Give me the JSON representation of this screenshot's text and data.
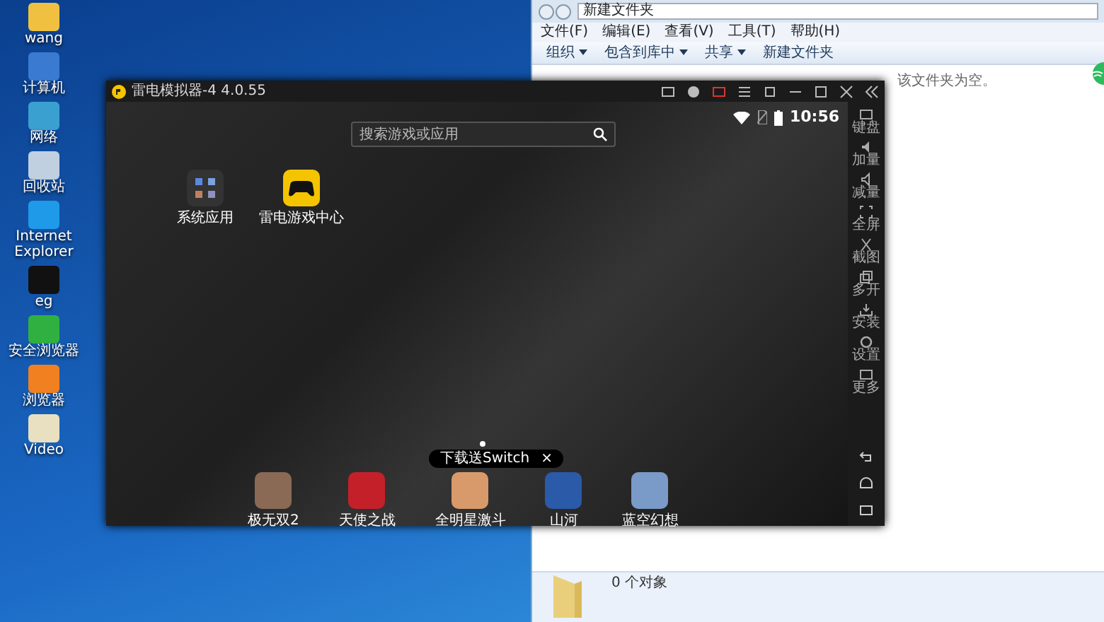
{
  "desktop_icons": [
    {
      "label": "wang"
    },
    {
      "label": "计算机"
    },
    {
      "label": "网络"
    },
    {
      "label": "回收站"
    },
    {
      "label": "Internet Explorer"
    },
    {
      "label": "eg"
    },
    {
      "label": "安全浏览器"
    },
    {
      "label": "浏览器"
    },
    {
      "label": "Video"
    }
  ],
  "explorer": {
    "address": "新建文件夹",
    "menu": [
      "文件(F)",
      "编辑(E)",
      "查看(V)",
      "工具(T)",
      "帮助(H)"
    ],
    "toolbar": [
      {
        "label": "组织",
        "dropdown": true
      },
      {
        "label": "包含到库中",
        "dropdown": true
      },
      {
        "label": "共享",
        "dropdown": true
      },
      {
        "label": "新建文件夹",
        "dropdown": false
      }
    ],
    "empty_message": "该文件夹为空。",
    "status": "0 个对象"
  },
  "emulator": {
    "title": "雷电模拟器-4 4.0.55",
    "time": "10:56",
    "search": {
      "placeholder": "搜索游戏或应用"
    },
    "home_apps": [
      {
        "label": "系统应用",
        "kind": "folder"
      },
      {
        "label": "雷电游戏中心",
        "kind": "gamepad"
      }
    ],
    "banner": {
      "text": "下载送Switch",
      "close": "×"
    },
    "dock_apps": [
      {
        "label": "极无双2",
        "color": "#8a6a55"
      },
      {
        "label": "天使之战",
        "color": "#c4202a"
      },
      {
        "label": "全明星激斗",
        "color": "#d89a6a"
      },
      {
        "label": "山河",
        "color": "#2a5aa8"
      },
      {
        "label": "蓝空幻想",
        "color": "#7a9ac8"
      }
    ],
    "sidebar": [
      {
        "label": "键盘"
      },
      {
        "label": "加量"
      },
      {
        "label": "减量"
      },
      {
        "label": "全屏"
      },
      {
        "label": "截图"
      },
      {
        "label": "多开"
      },
      {
        "label": "安装"
      },
      {
        "label": "设置"
      },
      {
        "label": "更多"
      }
    ]
  }
}
